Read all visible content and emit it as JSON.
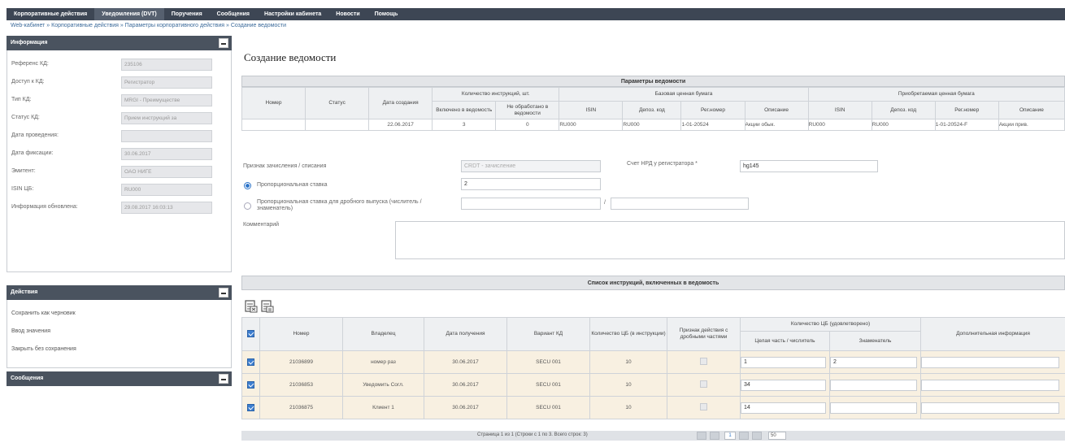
{
  "nav": {
    "items": [
      "Корпоративные действия",
      "Уведомления (DVT)",
      "Поручения",
      "Сообщения",
      "Настройки кабинета",
      "Новости",
      "Помощь"
    ],
    "active_index": 1
  },
  "breadcrumb": "Web-кабинет » Корпоративные действия » Параметры корпоративного действия » Создание ведомости",
  "sidebar": {
    "info_title": "Информация",
    "info_rows": [
      {
        "label": "Референс КД:",
        "value": "235106"
      },
      {
        "label": "Доступ к КД:",
        "value": "Регистратор"
      },
      {
        "label": "Тип КД:",
        "value": "MRGI - Преимуществе"
      },
      {
        "label": "Статус КД:",
        "value": "Прием инструкций за"
      },
      {
        "label": "Дата проведения:",
        "value": ""
      },
      {
        "label": "Дата фиксации:",
        "value": "30.06.2017"
      },
      {
        "label": "Эмитент:",
        "value": "OAO НИГЕ"
      },
      {
        "label": "ISIN ЦБ:",
        "value": "RU000"
      },
      {
        "label": "Информация обновлена:",
        "value": "29.08.2017 16:03:13"
      }
    ],
    "actions_title": "Действия",
    "actions": [
      "Сохранить как черновик",
      "Ввод значения",
      "Закрыть без сохранения"
    ],
    "messages_title": "Сообщения"
  },
  "page_title": "Создание ведомости",
  "params": {
    "title": "Параметры ведомости",
    "headers": {
      "number": "Номер",
      "status": "Статус",
      "created": "Дата создания",
      "instr_group": "Количество инструкций, шт.",
      "included": "Включено в ведомость",
      "not_processed": "Не обработано в ведомости",
      "base_group": "Базовая ценная бумага",
      "acq_group": "Приобретаемая ценная бумага",
      "isin": "ISIN",
      "depo": "Депоз. код",
      "reg": "Рег.номер",
      "desc": "Описание"
    },
    "row": {
      "number": "",
      "status": "",
      "created": "22.06.2017",
      "included": "3",
      "not_processed": "0",
      "b_isin": "RU000",
      "b_depo": "RU000",
      "b_reg": "1-01-20524",
      "b_desc": "Акции обык.",
      "a_isin": "RU000",
      "a_depo": "RU000",
      "a_reg": "1-01-20524-F",
      "a_desc": "Акции прив."
    }
  },
  "form": {
    "credit_label": "Признак зачисления / списания",
    "credit_value": "CRDT - зачисление",
    "account_label": "Счет НРД у регистратора *",
    "account_value": "hg145",
    "prop_rate_label": "Пропорциональная ставка",
    "prop_rate_value": "2",
    "frac_rate_label": "Пропорциональная ставка для дробного выпуска (числитель /знаменатель)",
    "frac_sep": "/",
    "comment_label": "Комментарий"
  },
  "list": {
    "title": "Список инструкций, включенных в ведомость",
    "headers": {
      "number": "Номер",
      "holder": "Владелец",
      "received": "Дата получения",
      "variant": "Вариант КД",
      "qty": "Количество ЦБ (в инструкции)",
      "frac": "Признак действия с дробными частями",
      "qty_group": "Количество ЦБ (удовлетворено)",
      "whole": "Целая часть / числитель",
      "denom": "Знаменатель",
      "extra": "Дополнительная информация"
    },
    "rows": [
      {
        "number": "21036899",
        "holder": "номер раз",
        "received": "30.06.2017",
        "variant": "SECU 001",
        "qty": "10",
        "whole": "1",
        "denom": "2"
      },
      {
        "number": "21036853",
        "holder": "Уведомить Согл.",
        "received": "30.06.2017",
        "variant": "SECU 001",
        "qty": "10",
        "whole": "34",
        "denom": ""
      },
      {
        "number": "21036875",
        "holder": "Клиент 1",
        "received": "30.06.2017",
        "variant": "SECU 001",
        "qty": "10",
        "whole": "14",
        "denom": ""
      }
    ]
  },
  "pager": {
    "text": "Страница 1 из 1 (Строки с 1 по 3. Всего строк: 3)",
    "current": "1",
    "page_size": "50"
  },
  "colors": {
    "nav_bg": "#3d4654",
    "panel_head": "#4a535f",
    "row_highlight": "#f8f0e1",
    "accent": "#2b73c8"
  }
}
